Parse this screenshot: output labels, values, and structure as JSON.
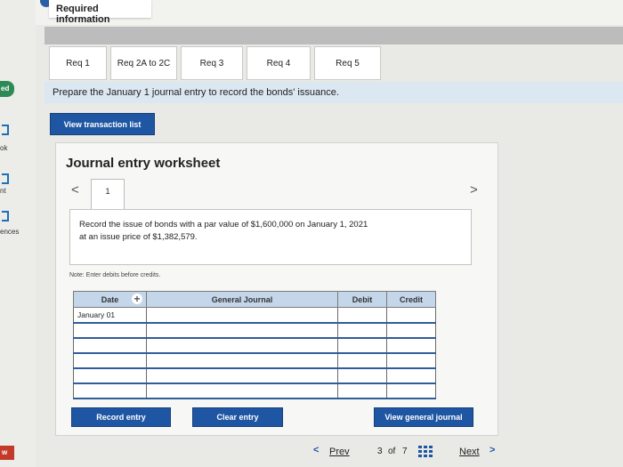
{
  "sidebar_fragments": {
    "badge": "ed",
    "frag_ok": "ok",
    "frag_nt": "nt",
    "frag_ences": "ences",
    "bottom_badge": "w"
  },
  "header": {
    "required_info": "Required information"
  },
  "tabs": [
    {
      "label": "Req 1"
    },
    {
      "label": "Req 2A to 2C"
    },
    {
      "label": "Req 3"
    },
    {
      "label": "Req 4"
    },
    {
      "label": "Req 5"
    }
  ],
  "instruction": "Prepare the January 1 journal entry to record the bonds' issuance.",
  "view_transaction_label": "View transaction list",
  "worksheet": {
    "title": "Journal entry worksheet",
    "prev_glyph": "<",
    "next_glyph": ">",
    "entry_number": "1",
    "description_line1": "Record the issue of bonds with a par value of $1,600,000 on January 1, 2021",
    "description_line2": "at an issue price of $1,382,579.",
    "note": "Note: Enter debits before credits."
  },
  "journal_table": {
    "headers": {
      "date": "Date",
      "account": "General Journal",
      "debit": "Debit",
      "credit": "Credit"
    },
    "add_icon": "+",
    "rows": [
      {
        "date": "January 01",
        "account": "",
        "debit": "",
        "credit": ""
      },
      {
        "date": "",
        "account": "",
        "debit": "",
        "credit": ""
      },
      {
        "date": "",
        "account": "",
        "debit": "",
        "credit": ""
      },
      {
        "date": "",
        "account": "",
        "debit": "",
        "credit": ""
      },
      {
        "date": "",
        "account": "",
        "debit": "",
        "credit": ""
      },
      {
        "date": "",
        "account": "",
        "debit": "",
        "credit": ""
      }
    ]
  },
  "buttons": {
    "record_entry": "Record entry",
    "clear_entry": "Clear entry",
    "view_general_journal": "View general journal"
  },
  "pagination": {
    "prev_glyph": "<",
    "prev_label": "Prev",
    "page_current": "3",
    "page_sep": "of",
    "page_total": "7",
    "next_label": "Next",
    "next_glyph": ">"
  },
  "colors": {
    "primary_button": "#1f56a3",
    "instruction_band": "#dbe7f1",
    "table_header": "#c4d6ea"
  }
}
